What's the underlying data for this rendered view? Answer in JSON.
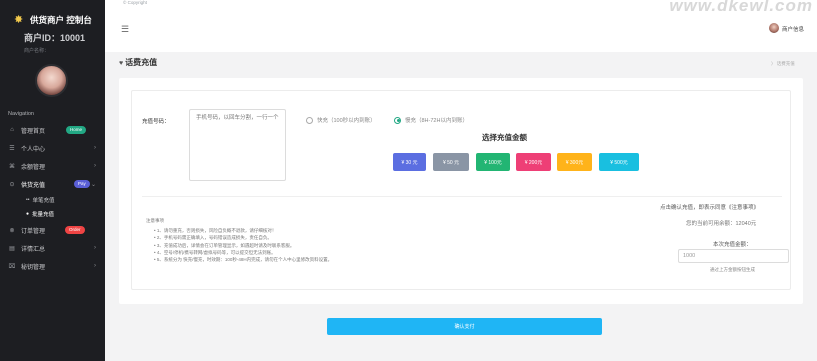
{
  "brand": {
    "title": "供货商户 控制台",
    "logo_icon": "sun-logo-icon"
  },
  "merchant": {
    "id_text": "商户ID：10001",
    "name_text": "商户名称："
  },
  "header": {
    "copyright": "© Copyright",
    "watermark": "www.dkewl.com",
    "user_info": "商户信息"
  },
  "nav": {
    "heading": "Navigation",
    "items": [
      {
        "icon": "home-icon",
        "glyph": "⌂",
        "label": "管理首页",
        "badge": "Home"
      },
      {
        "icon": "user-icon",
        "glyph": "☰",
        "label": "个人中心",
        "chevron": "›"
      },
      {
        "icon": "money-icon",
        "glyph": "⌘",
        "label": "余额管理",
        "chevron": "›"
      },
      {
        "icon": "recharge-icon",
        "glyph": "⊙",
        "label": "供货充值",
        "badge": "Pay",
        "chevron": "⌄"
      },
      {
        "icon": "order-icon",
        "glyph": "⊗",
        "label": "订单管理",
        "badge": "Order"
      },
      {
        "icon": "report-icon",
        "glyph": "▤",
        "label": "详情汇总",
        "chevron": "›"
      },
      {
        "icon": "key-icon",
        "glyph": "⌧",
        "label": "秘钥管理",
        "chevron": "›"
      }
    ],
    "sub_items": [
      {
        "label": "单笔充值",
        "dot": "••"
      },
      {
        "label": "批量充值",
        "dot": "●"
      }
    ]
  },
  "page": {
    "title": "话费充值",
    "breadcrumb": "〉 话费充值"
  },
  "form": {
    "phone_label": "充值号码：",
    "phone_placeholder": "手机号码，以回车分割，一行一个",
    "radio_fast": "快充（100秒以内到账）",
    "radio_slow": "慢充（8H-72H以内到账）",
    "amount_title": "选择充值金额",
    "amounts": [
      "¥ 30 元",
      "¥ 50 元",
      "¥ 100元",
      "¥ 200元",
      "¥ 300元",
      "¥ 500元"
    ],
    "amount_colors": [
      "#5b6ee1",
      "#8a95a5",
      "#22b573",
      "#ee3f76",
      "#ffb31a",
      "#19bfe0"
    ]
  },
  "notes": {
    "title": "注意事项",
    "items": [
      "• 1、请勿重充，否则损失，风险自负概不退款，请仔细核对！",
      "• 2、手机号码需正确填入，号码错误造成损失，责任自负。",
      "• 3、充值成功后，详情会在订单管理显示，如遇超时请及时联系客服。",
      "• 4、空号/停机/携号转网/虚拟号码等，可以提交但无法到账。",
      "• 5、系统分为 快充/慢充，时效期：100秒-48H内完成，请勿在个人中心里修改资料设置。"
    ]
  },
  "summary": {
    "confirm_hint": "点击确认充值，即表示同意《注意事项》",
    "balance": "您的当前可用余额：12040元",
    "sum_label": "本次充值金额：",
    "sum_value": "1000",
    "sum_note": "通过上方金额按钮生成"
  },
  "submit_label": "确认支付"
}
